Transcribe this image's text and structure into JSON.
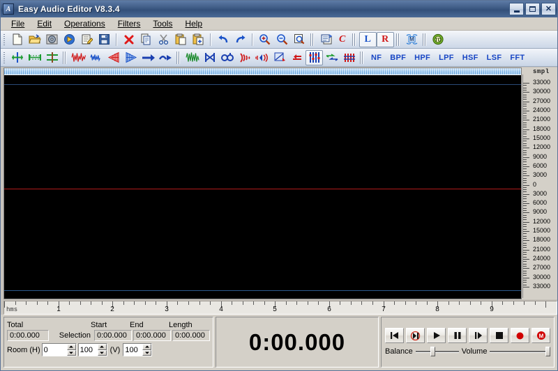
{
  "window": {
    "title": "Easy Audio Editor V8.3.4",
    "app_icon": "app-icon",
    "minimize_label": "",
    "maximize_label": "",
    "close_label": "✕"
  },
  "menu": {
    "items": [
      {
        "label": "File"
      },
      {
        "label": "Edit"
      },
      {
        "label": "Operations"
      },
      {
        "label": "Filters"
      },
      {
        "label": "Tools"
      },
      {
        "label": "Help"
      }
    ]
  },
  "toolbar_main": {
    "buttons": [
      {
        "name": "new-file-icon"
      },
      {
        "name": "open-file-icon"
      },
      {
        "name": "open-cd-icon"
      },
      {
        "name": "play-file-icon"
      },
      {
        "name": "edit-file-icon"
      },
      {
        "name": "save-file-icon"
      },
      {
        "name": "delete-icon"
      },
      {
        "name": "copy-icon"
      },
      {
        "name": "cut-icon"
      },
      {
        "name": "paste-icon"
      },
      {
        "name": "paste-new-icon"
      },
      {
        "name": "undo-icon"
      },
      {
        "name": "redo-icon"
      },
      {
        "name": "zoom-in-icon"
      },
      {
        "name": "zoom-out-icon"
      },
      {
        "name": "zoom-selection-icon"
      },
      {
        "name": "batch-convert-icon"
      },
      {
        "name": "convert-icon"
      },
      {
        "name": "left-channel-icon"
      },
      {
        "name": "right-channel-icon"
      },
      {
        "name": "mono-channel-icon"
      },
      {
        "name": "trim-silence-icon"
      }
    ],
    "left_channel_label": "L",
    "right_channel_label": "R",
    "mono_label": "M",
    "convert_label": "C"
  },
  "toolbar_effects": {
    "buttons": [
      {
        "name": "insert-marker-icon"
      },
      {
        "name": "select-range-icon"
      },
      {
        "name": "split-icon"
      },
      {
        "name": "amplify-icon"
      },
      {
        "name": "normalize-icon"
      },
      {
        "name": "fade-in-icon"
      },
      {
        "name": "fade-out-icon"
      },
      {
        "name": "forward-icon"
      },
      {
        "name": "reverse-icon"
      },
      {
        "name": "vibrato-icon"
      },
      {
        "name": "crossfade-icon"
      },
      {
        "name": "chorus-icon"
      },
      {
        "name": "echo-icon"
      },
      {
        "name": "flanger-icon"
      },
      {
        "name": "reverb-icon"
      },
      {
        "name": "invert-icon"
      },
      {
        "name": "equalizer-icon"
      },
      {
        "name": "pitch-shift-icon"
      },
      {
        "name": "noise-gate-icon"
      }
    ],
    "filters": [
      {
        "label": "NF",
        "name": "notch-filter-button"
      },
      {
        "label": "BPF",
        "name": "band-pass-filter-button"
      },
      {
        "label": "HPF",
        "name": "high-pass-filter-button"
      },
      {
        "label": "LPF",
        "name": "low-pass-filter-button"
      },
      {
        "label": "HSF",
        "name": "high-shelf-filter-button"
      },
      {
        "label": "LSF",
        "name": "low-shelf-filter-button"
      },
      {
        "label": "FFT",
        "name": "fft-filter-button"
      }
    ]
  },
  "wave": {
    "amp_ruler_title": "smpl",
    "amp_labels_top": [
      "33000",
      "30000",
      "27000",
      "24000",
      "21000",
      "18000",
      "15000",
      "12000",
      "9000",
      "6000",
      "3000",
      "0"
    ],
    "amp_labels_bottom": [
      "3000",
      "6000",
      "9000",
      "12000",
      "15000",
      "18000",
      "21000",
      "24000",
      "27000",
      "30000",
      "33000"
    ],
    "time_ruler_unit": "hms",
    "time_labels": [
      "1",
      "2",
      "3",
      "4",
      "5",
      "6",
      "7",
      "8",
      "9"
    ],
    "center_line_color": "#b11a1a",
    "channel_line_color": "#2d5a8e",
    "background_color": "#000000"
  },
  "status": {
    "total_label": "Total",
    "total_value": "0:00.000",
    "selection_label": "Selection",
    "start_label": "Start",
    "start_value": "0:00.000",
    "end_label": "End",
    "end_value": "0:00.000",
    "length_label": "Length",
    "length_value": "0:00.000",
    "room_label": "Room (H)",
    "room_h_offset": "0",
    "room_h_zoom": "100",
    "room_v_label": "(V)",
    "room_v_zoom": "100"
  },
  "time_display": {
    "value": "0:00.000"
  },
  "transport": {
    "buttons": [
      {
        "name": "skip-start-button",
        "label": "⏮"
      },
      {
        "name": "loop-play-button",
        "label": "loop"
      },
      {
        "name": "play-button",
        "label": "▶"
      },
      {
        "name": "pause-button",
        "label": "⏸"
      },
      {
        "name": "step-forward-button",
        "label": "⏭"
      },
      {
        "name": "stop-button",
        "label": "■"
      },
      {
        "name": "record-button",
        "label": "●"
      },
      {
        "name": "record-monitor-button",
        "label": "M"
      }
    ],
    "balance_label": "Balance",
    "balance_value": 38,
    "volume_label": "Volume",
    "volume_value": 100,
    "record_color": "#d00000"
  }
}
